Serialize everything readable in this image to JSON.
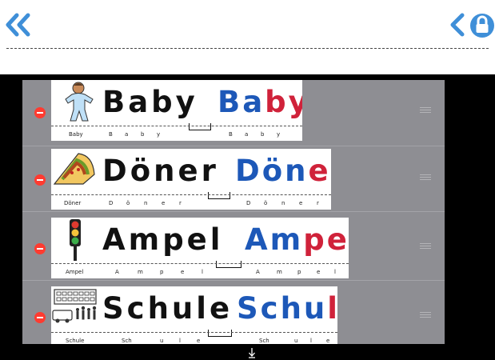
{
  "words": [
    {
      "word": "Baby",
      "black": "Baby",
      "blue": "Ba",
      "red": "by",
      "tail": "",
      "small_label": "Baby",
      "small_left": [
        "B",
        "a",
        "b",
        "y"
      ],
      "small_right": [
        "B",
        "a",
        "b",
        "y"
      ],
      "icon": "baby-icon"
    },
    {
      "word": "Döner",
      "black": "Döner",
      "blue": "Dön",
      "red": "er",
      "tail": "",
      "small_label": "Döner",
      "small_left": [
        "D",
        "ö",
        "n",
        "e",
        "r"
      ],
      "small_right": [
        "D",
        "ö",
        "n",
        "e",
        "r"
      ],
      "icon": "doner-kebab-icon"
    },
    {
      "word": "Ampel",
      "black": "Ampel",
      "blue": "Am",
      "red": "pel",
      "tail": "",
      "small_label": "Ampel",
      "small_left": [
        "A",
        "m",
        "p",
        "e",
        "l"
      ],
      "small_right": [
        "A",
        "m",
        "p",
        "e",
        "l"
      ],
      "icon": "traffic-light-icon"
    },
    {
      "word": "Schule",
      "black": "Schule",
      "blue": "Schu",
      "red": "le",
      "tail": "",
      "small_label": "Schule",
      "small_left": [
        "Sch",
        "u",
        "l",
        "e"
      ],
      "small_right": [
        "Sch",
        "u",
        "l",
        "e"
      ],
      "icon": "school-icon"
    }
  ],
  "colors": {
    "blue": "#1d58b8",
    "red": "#d0223a",
    "accent": "#3f8fd8",
    "delete": "#ff3b30"
  },
  "icons": {
    "back": "double-chevron-left-icon",
    "previous": "chevron-left-icon",
    "lock": "lock-icon",
    "scroll": "arrow-down-icon"
  }
}
